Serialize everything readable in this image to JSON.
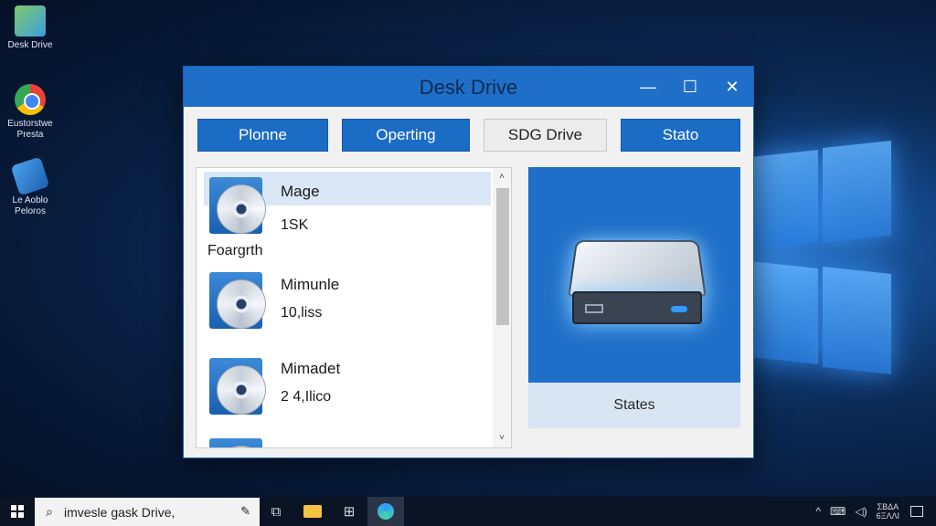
{
  "desktop": {
    "icons": [
      {
        "label": "Desk Drive"
      },
      {
        "label": "Eustorstwe Presta"
      },
      {
        "label": "Le Aoblo Peloros"
      }
    ]
  },
  "window": {
    "title": "Desk Drive",
    "controls": {
      "minimize": "—",
      "maximize": "☐",
      "close": "✕"
    }
  },
  "toolbar": {
    "buttons": [
      {
        "label": "Plonne"
      },
      {
        "label": "Operting"
      },
      {
        "label": "SDG Drive"
      },
      {
        "label": "Stato"
      }
    ]
  },
  "list": {
    "items": [
      {
        "name": "Mage",
        "size": "1SK",
        "caption": "Foargrth",
        "selected": true
      },
      {
        "name": "Mimunle",
        "size": "10,liss"
      },
      {
        "name": "Mimadet",
        "size": "2 4,Ilico"
      },
      {
        "name": "",
        "size": ""
      }
    ],
    "scroll_up": "˄",
    "scroll_down": "˅"
  },
  "drive_panel": {
    "status_label": "States"
  },
  "taskbar": {
    "search_placeholder": "imvesle gask Drive,",
    "search_icon": "⌕",
    "mic_icon": "✎",
    "apps": [
      "task-view-icon",
      "file-explorer-icon",
      "store-icon",
      "edge-icon"
    ],
    "task_view_glyph": "⧉",
    "store_glyph": "⊞",
    "tray": {
      "chevron": "^",
      "network": "⌨",
      "volume": "◁)"
    },
    "clock_time": "ΣΒΔΑ",
    "clock_date": "6ΞΛΛΙ"
  }
}
